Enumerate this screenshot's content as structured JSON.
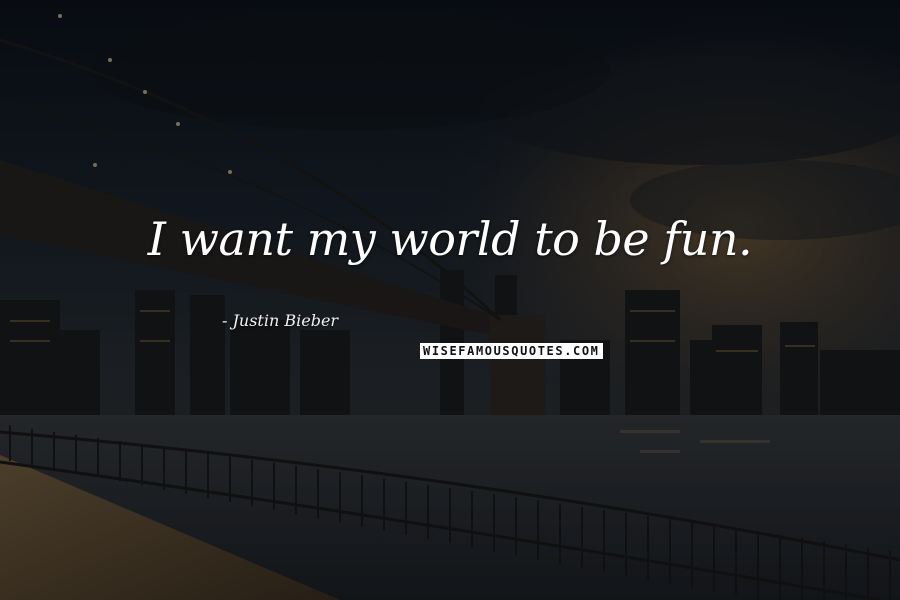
{
  "quote": {
    "text": "I want my world to be fun.",
    "author": "- Justin Bieber"
  },
  "watermark": {
    "text": "WISEFAMOUSQUOTES.COM"
  },
  "background": {
    "description_icon": "city-bridge-night-photo",
    "colors": {
      "sky_dark": "#10161f",
      "sky_mid": "#26303c",
      "sunset_glow": "#7a5a34",
      "water": "#2b3038",
      "boardwalk": "#6e5a3e"
    }
  }
}
